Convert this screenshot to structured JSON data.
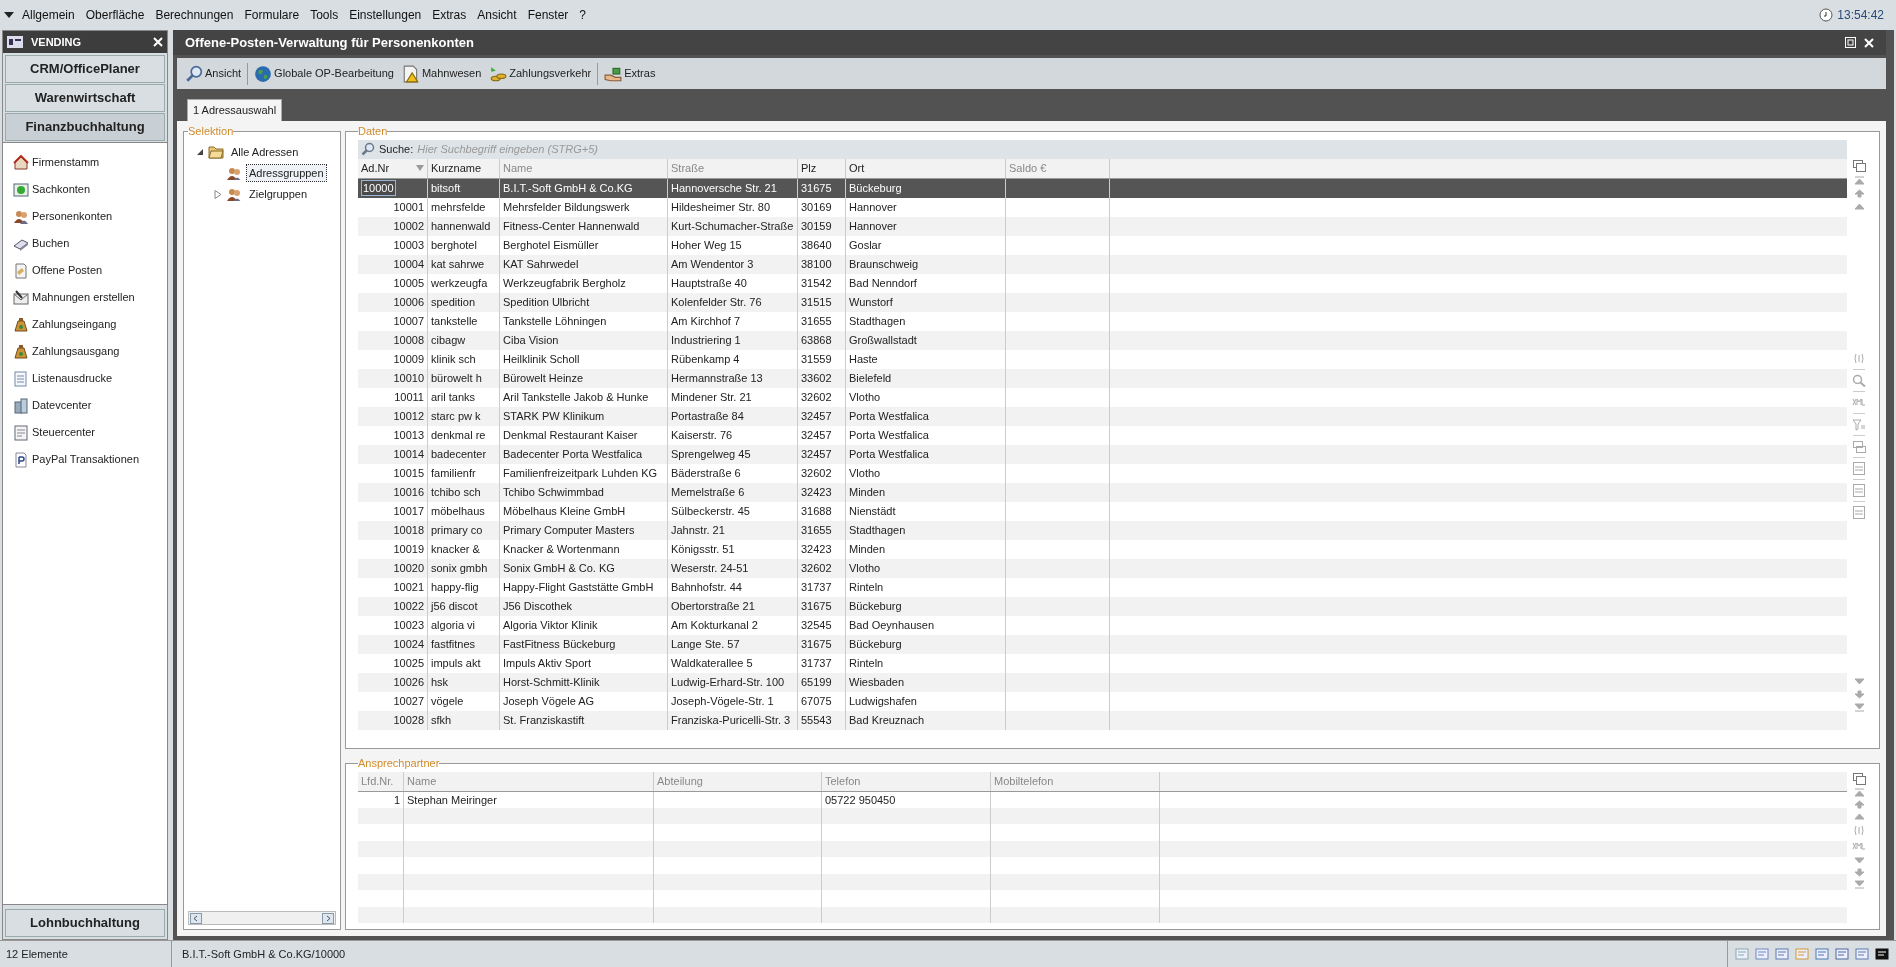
{
  "menu": [
    "Allgemein",
    "Oberfläche",
    "Berechnungen",
    "Formulare",
    "Tools",
    "Einstellungen",
    "Extras",
    "Ansicht",
    "Fenster",
    "?"
  ],
  "clock": "13:54:42",
  "sidebar": {
    "title": "VENDING",
    "modules": [
      {
        "label": "CRM/OfficePlaner",
        "expanded": false
      },
      {
        "label": "Warenwirtschaft",
        "expanded": false
      },
      {
        "label": "Finanzbuchhaltung",
        "expanded": true
      }
    ],
    "items": [
      "Firmenstamm",
      "Sachkonten",
      "Personenkonten",
      "Buchen",
      "Offene Posten",
      "Mahnungen erstellen",
      "Zahlungseingang",
      "Zahlungsausgang",
      "Listenausdrucke",
      "Datevcenter",
      "Steuercenter",
      "PayPal Transaktionen"
    ],
    "bottom_module": {
      "label": "Lohnbuchhaltung",
      "expanded": false
    }
  },
  "window": {
    "title": "Offene-Posten-Verwaltung für Personenkonten"
  },
  "toolbar": [
    "Ansicht",
    "Globale OP-Bearbeitung",
    "Mahnwesen",
    "Zahlungsverkehr",
    "Extras"
  ],
  "tabs": [
    {
      "label": "1 Adressauswahl",
      "selected": true
    }
  ],
  "selection": {
    "title": "Selektion",
    "tree": [
      {
        "label": "Alle Adressen",
        "expanded": true,
        "selected": false,
        "children": [
          {
            "label": "Adressgruppen",
            "selected": true
          },
          {
            "label": "Zielgruppen",
            "expanded": false,
            "selected": false
          }
        ]
      }
    ]
  },
  "data": {
    "title": "Daten",
    "search_label": "Suche:",
    "search_placeholder": "Hier Suchbegriff eingeben (STRG+5)",
    "columns": [
      {
        "label": "Ad.Nr",
        "sorted": true,
        "dimmed": false
      },
      {
        "label": "Kurzname",
        "sorted": false,
        "dimmed": false
      },
      {
        "label": "Name",
        "sorted": false,
        "dimmed": true
      },
      {
        "label": "Straße",
        "sorted": false,
        "dimmed": true
      },
      {
        "label": "Plz",
        "sorted": false,
        "dimmed": false
      },
      {
        "label": "Ort",
        "sorted": false,
        "dimmed": false
      },
      {
        "label": "Saldo €",
        "sorted": false,
        "dimmed": true
      }
    ],
    "rows": [
      {
        "ad_nr": "10000",
        "kurzname": "bitsoft",
        "name": "B.I.T.-Soft GmbH & Co.KG",
        "strasse": "Hannoversche Str. 21",
        "plz": "31675",
        "ort": "Bückeburg",
        "selected": true
      },
      {
        "ad_nr": "10001",
        "kurzname": "mehrsfelde",
        "name": "Mehrsfelder Bildungswerk",
        "strasse": "Hildesheimer Str. 80",
        "plz": "30169",
        "ort": "Hannover",
        "selected": false
      },
      {
        "ad_nr": "10002",
        "kurzname": "hannenwald",
        "name": "Fitness-Center Hannenwald",
        "strasse": "Kurt-Schumacher-Straße",
        "plz": "30159",
        "ort": "Hannover",
        "selected": false
      },
      {
        "ad_nr": "10003",
        "kurzname": "berghotel",
        "name": "Berghotel Eismüller",
        "strasse": "Hoher Weg 15",
        "plz": "38640",
        "ort": "Goslar",
        "selected": false
      },
      {
        "ad_nr": "10004",
        "kurzname": "kat sahrwe",
        "name": "KAT Sahrwedel",
        "strasse": "Am Wendentor 3",
        "plz": "38100",
        "ort": "Braunschweig",
        "selected": false
      },
      {
        "ad_nr": "10005",
        "kurzname": "werkzeugfa",
        "name": "Werkzeugfabrik Bergholz",
        "strasse": "Hauptstraße 40",
        "plz": "31542",
        "ort": "Bad Nenndorf",
        "selected": false
      },
      {
        "ad_nr": "10006",
        "kurzname": "spedition",
        "name": "Spedition Ulbricht",
        "strasse": "Kolenfelder Str. 76",
        "plz": "31515",
        "ort": "Wunstorf",
        "selected": false
      },
      {
        "ad_nr": "10007",
        "kurzname": "tankstelle",
        "name": "Tankstelle Löhningen",
        "strasse": "Am Kirchhof 7",
        "plz": "31655",
        "ort": "Stadthagen",
        "selected": false
      },
      {
        "ad_nr": "10008",
        "kurzname": "cibagw",
        "name": "Ciba Vision",
        "strasse": "Industriering 1",
        "plz": "63868",
        "ort": "Großwallstadt",
        "selected": false
      },
      {
        "ad_nr": "10009",
        "kurzname": "klinik sch",
        "name": "Heilklinik Scholl",
        "strasse": "Rübenkamp 4",
        "plz": "31559",
        "ort": "Haste",
        "selected": false
      },
      {
        "ad_nr": "10010",
        "kurzname": "bürowelt h",
        "name": "Bürowelt Heinze",
        "strasse": "Hermannstraße 13",
        "plz": "33602",
        "ort": "Bielefeld",
        "selected": false
      },
      {
        "ad_nr": "10011",
        "kurzname": "aril tanks",
        "name": "Aril Tankstelle Jakob & Hunke",
        "strasse": "Mindener Str. 21",
        "plz": "32602",
        "ort": "Vlotho",
        "selected": false
      },
      {
        "ad_nr": "10012",
        "kurzname": "starc pw k",
        "name": "STARK PW Klinikum",
        "strasse": "Portastraße 84",
        "plz": "32457",
        "ort": "Porta Westfalica",
        "selected": false
      },
      {
        "ad_nr": "10013",
        "kurzname": "denkmal re",
        "name": "Denkmal Restaurant Kaiser",
        "strasse": "Kaiserstr. 76",
        "plz": "32457",
        "ort": "Porta Westfalica",
        "selected": false
      },
      {
        "ad_nr": "10014",
        "kurzname": "badecenter",
        "name": "Badecenter Porta Westfalica",
        "strasse": "Sprengelweg 45",
        "plz": "32457",
        "ort": "Porta Westfalica",
        "selected": false
      },
      {
        "ad_nr": "10015",
        "kurzname": "familienfr",
        "name": "Familienfreizeitpark Luhden KG",
        "strasse": "Bäderstraße 6",
        "plz": "32602",
        "ort": "Vlotho",
        "selected": false
      },
      {
        "ad_nr": "10016",
        "kurzname": "tchibo sch",
        "name": "Tchibo Schwimmbad",
        "strasse": "Memelstraße 6",
        "plz": "32423",
        "ort": "Minden",
        "selected": false
      },
      {
        "ad_nr": "10017",
        "kurzname": "möbelhaus",
        "name": "Möbelhaus Kleine GmbH",
        "strasse": "Sülbeckerstr. 45",
        "plz": "31688",
        "ort": "Nienstädt",
        "selected": false
      },
      {
        "ad_nr": "10018",
        "kurzname": "primary co",
        "name": "Primary Computer Masters",
        "strasse": "Jahnstr. 21",
        "plz": "31655",
        "ort": "Stadthagen",
        "selected": false
      },
      {
        "ad_nr": "10019",
        "kurzname": "knacker &",
        "name": "Knacker & Wortenmann",
        "strasse": "Königsstr. 51",
        "plz": "32423",
        "ort": "Minden",
        "selected": false
      },
      {
        "ad_nr": "10020",
        "kurzname": "sonix gmbh",
        "name": "Sonix GmbH & Co. KG",
        "strasse": "Weserstr. 24-51",
        "plz": "32602",
        "ort": "Vlotho",
        "selected": false
      },
      {
        "ad_nr": "10021",
        "kurzname": "happy-flig",
        "name": "Happy-Flight Gaststätte GmbH",
        "strasse": "Bahnhofstr. 44",
        "plz": "31737",
        "ort": "Rinteln",
        "selected": false
      },
      {
        "ad_nr": "10022",
        "kurzname": "j56 discot",
        "name": "J56 Discothek",
        "strasse": "Obertorstraße 21",
        "plz": "31675",
        "ort": "Bückeburg",
        "selected": false
      },
      {
        "ad_nr": "10023",
        "kurzname": "algoria vi",
        "name": "Algoria Viktor Klinik",
        "strasse": "Am Kokturkanal 2",
        "plz": "32545",
        "ort": "Bad Oeynhausen",
        "selected": false
      },
      {
        "ad_nr": "10024",
        "kurzname": "fastfitnes",
        "name": "FastFitness Bückeburg",
        "strasse": "Lange Ste. 57",
        "plz": "31675",
        "ort": "Bückeburg",
        "selected": false
      },
      {
        "ad_nr": "10025",
        "kurzname": "impuls akt",
        "name": "Impuls Aktiv Sport",
        "strasse": "Waldkaterallee 5",
        "plz": "31737",
        "ort": "Rinteln",
        "selected": false
      },
      {
        "ad_nr": "10026",
        "kurzname": "hsk",
        "name": "Horst-Schmitt-Klinik",
        "strasse": "Ludwig-Erhard-Str. 100",
        "plz": "65199",
        "ort": "Wiesbaden",
        "selected": false
      },
      {
        "ad_nr": "10027",
        "kurzname": "vögele",
        "name": "Joseph Vögele AG",
        "strasse": "Joseph-Vögele-Str. 1",
        "plz": "67075",
        "ort": "Ludwigshafen",
        "selected": false
      },
      {
        "ad_nr": "10028",
        "kurzname": "sfkh",
        "name": "St. Franziskastift",
        "strasse": "Franziska-Puricelli-Str. 3",
        "plz": "55543",
        "ort": "Bad Kreuznach",
        "selected": false
      }
    ]
  },
  "contacts": {
    "title": "Ansprechpartner",
    "columns": [
      "Lfd.Nr.",
      "Name",
      "Abteilung",
      "Telefon",
      "Mobiltelefon"
    ],
    "rows": [
      {
        "lfd_nr": "1",
        "name": "Stephan Meiringer",
        "telefon": "05722 950450"
      }
    ]
  },
  "status_bar": {
    "count": "12 Elemente",
    "record": "B.I.T.-Soft GmbH & Co.KG/10000"
  }
}
